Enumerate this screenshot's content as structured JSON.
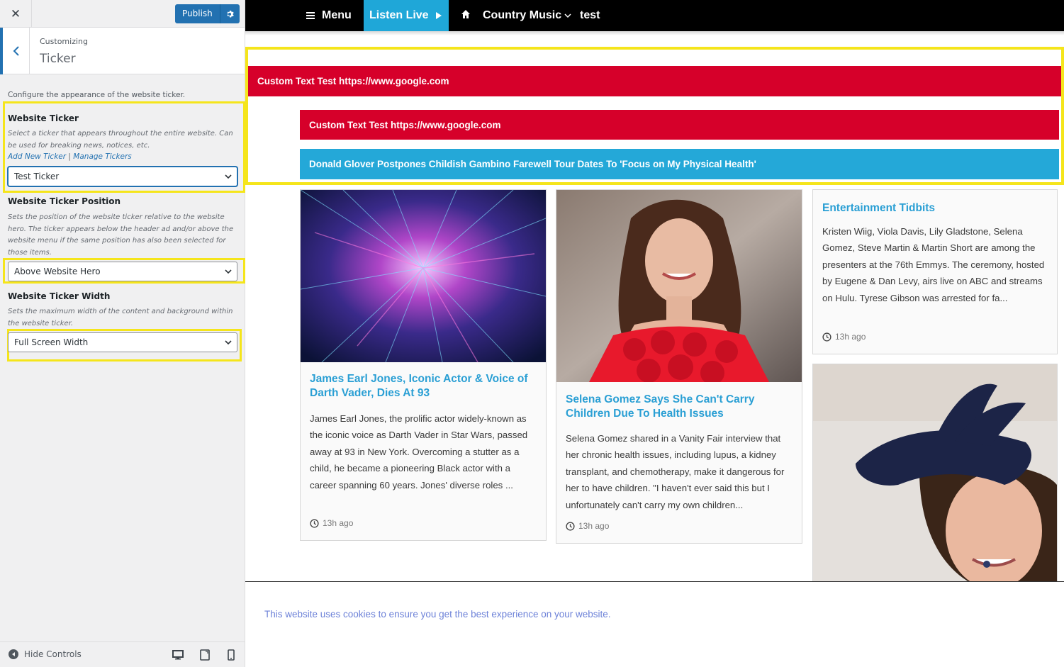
{
  "customizer": {
    "publish_label": "Publish",
    "breadcrumb_parent": "Customizing",
    "section_title": "Ticker",
    "section_description": "Configure the appearance of the website ticker.",
    "controls": [
      {
        "label": "Website Ticker",
        "description": "Select a ticker that appears throughout the entire website. Can be used for breaking news, notices, etc.",
        "link_add": "Add New Ticker",
        "link_sep": "|",
        "link_manage": "Manage Tickers",
        "value": "Test Ticker"
      },
      {
        "label": "Website Ticker Position",
        "description": "Sets the position of the website ticker relative to the website hero. The ticker appears below the header ad and/or above the website menu if the same position has also been selected for those items.",
        "value": "Above Website Hero"
      },
      {
        "label": "Website Ticker Width",
        "description": "Sets the maximum width of the content and background within the website ticker.",
        "value": "Full Screen Width"
      }
    ],
    "hide_controls_label": "Hide Controls"
  },
  "nav": {
    "menu_label": "Menu",
    "listen_live_label": "Listen Live",
    "station_label": "Country Music",
    "test_label": "test"
  },
  "tickers": [
    "Custom Text Test https://www.google.com",
    "Custom Text Test https://www.google.com",
    "Donald Glover Postpones Childish Gambino Farewell Tour Dates To 'Focus on My Physical Health'"
  ],
  "cards": [
    {
      "title": "James Earl Jones, Iconic Actor & Voice of Darth Vader, Dies At 93",
      "excerpt": "James Earl Jones, the prolific actor widely-known as the iconic voice as Darth Vader in Star Wars, passed away at 93 in New York. Overcoming a stutter as a child, he became a pioneering Black actor with a career spanning 60 years. Jones' diverse roles ...",
      "time": "13h ago"
    },
    {
      "title": "Selena Gomez Says She Can't Carry Children Due To Health Issues",
      "excerpt": "Selena Gomez shared in a Vanity Fair interview that her chronic health issues, including lupus, a kidney transplant, and chemotherapy, make it dangerous for her to have children. \"I haven't ever said this but I unfortunately can't carry my own children...",
      "time": "13h ago"
    },
    {
      "title": "Entertainment Tidbits",
      "excerpt": "Kristen Wiig, Viola Davis, Lily Gladstone, Selena Gomez, Steve Martin & Martin Short are among the presenters at the 76th Emmys. The ceremony, hosted by Eugene & Dan Levy, airs live on ABC and streams on Hulu. Tyrese Gibson was arrested for fa...",
      "time": "13h ago"
    }
  ],
  "cookie_notice": "This website uses cookies to ensure you get the best experience on your website.",
  "colors": {
    "ticker_red": "#d6002a",
    "ticker_blue": "#24a8d8",
    "highlight": "#f5e51b",
    "wp_blue": "#2271b1"
  }
}
